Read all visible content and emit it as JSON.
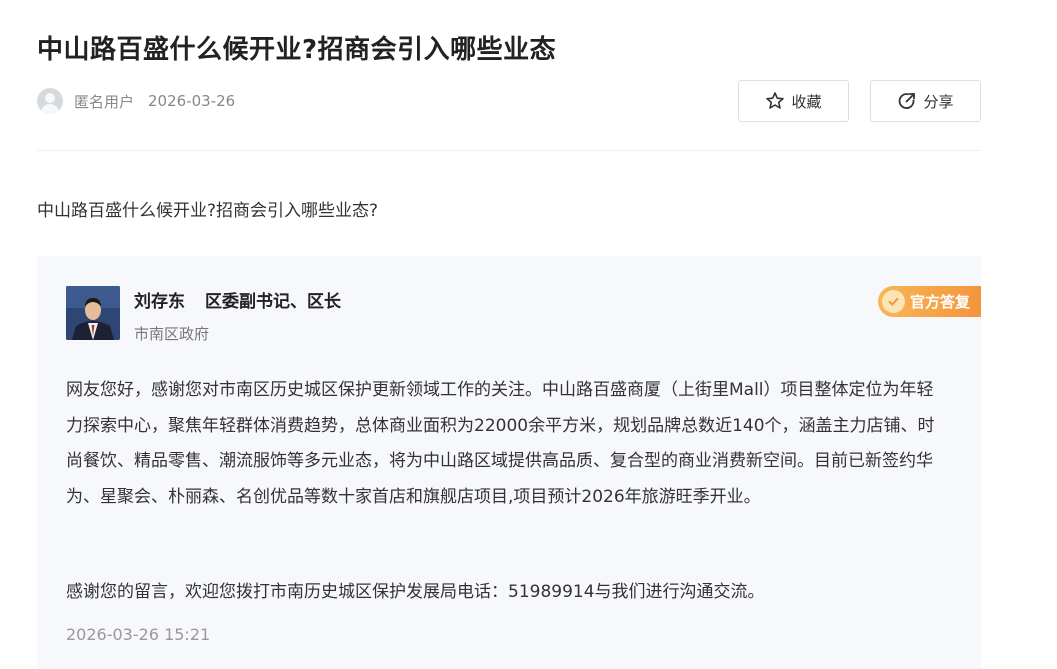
{
  "page": {
    "title": "中山路百盛什么候开业?招商会引入哪些业态"
  },
  "meta": {
    "user": "匿名用户",
    "date": "2026-03-26"
  },
  "actions": {
    "favorite_label": "收藏",
    "share_label": "分享"
  },
  "question": {
    "text": "中山路百盛什么候开业?招商会引入哪些业态?"
  },
  "answer": {
    "responder_name": "刘存东",
    "responder_title": "区委副书记、区长",
    "responder_org": "市南区政府",
    "badge": "官方答复",
    "body": "网友您好，感谢您对市南区历史城区保护更新领域工作的关注。中山路百盛商厦（上街里Mall）项目整体定位为年轻力探索中心，聚焦年轻群体消费趋势，总体商业面积为22000余平方米，规划品牌总数近140个，涵盖主力店铺、时尚餐饮、精品零售、潮流服饰等多元业态，将为中山路区域提供高品质、复合型的商业消费新空间。目前已新签约华为、星聚会、朴丽森、名创优品等数十家首店和旗舰店项目,项目预计2026年旅游旺季开业。",
    "thanks": "感谢您的留言，欢迎您拨打市南历史城区保护发展局电话：51989914与我们进行沟通交流。",
    "time": "2026-03-26 15:21"
  },
  "colors": {
    "badge_start": "#f8b657",
    "badge_end": "#f4953c",
    "card_bg": "#f7f8fc"
  }
}
